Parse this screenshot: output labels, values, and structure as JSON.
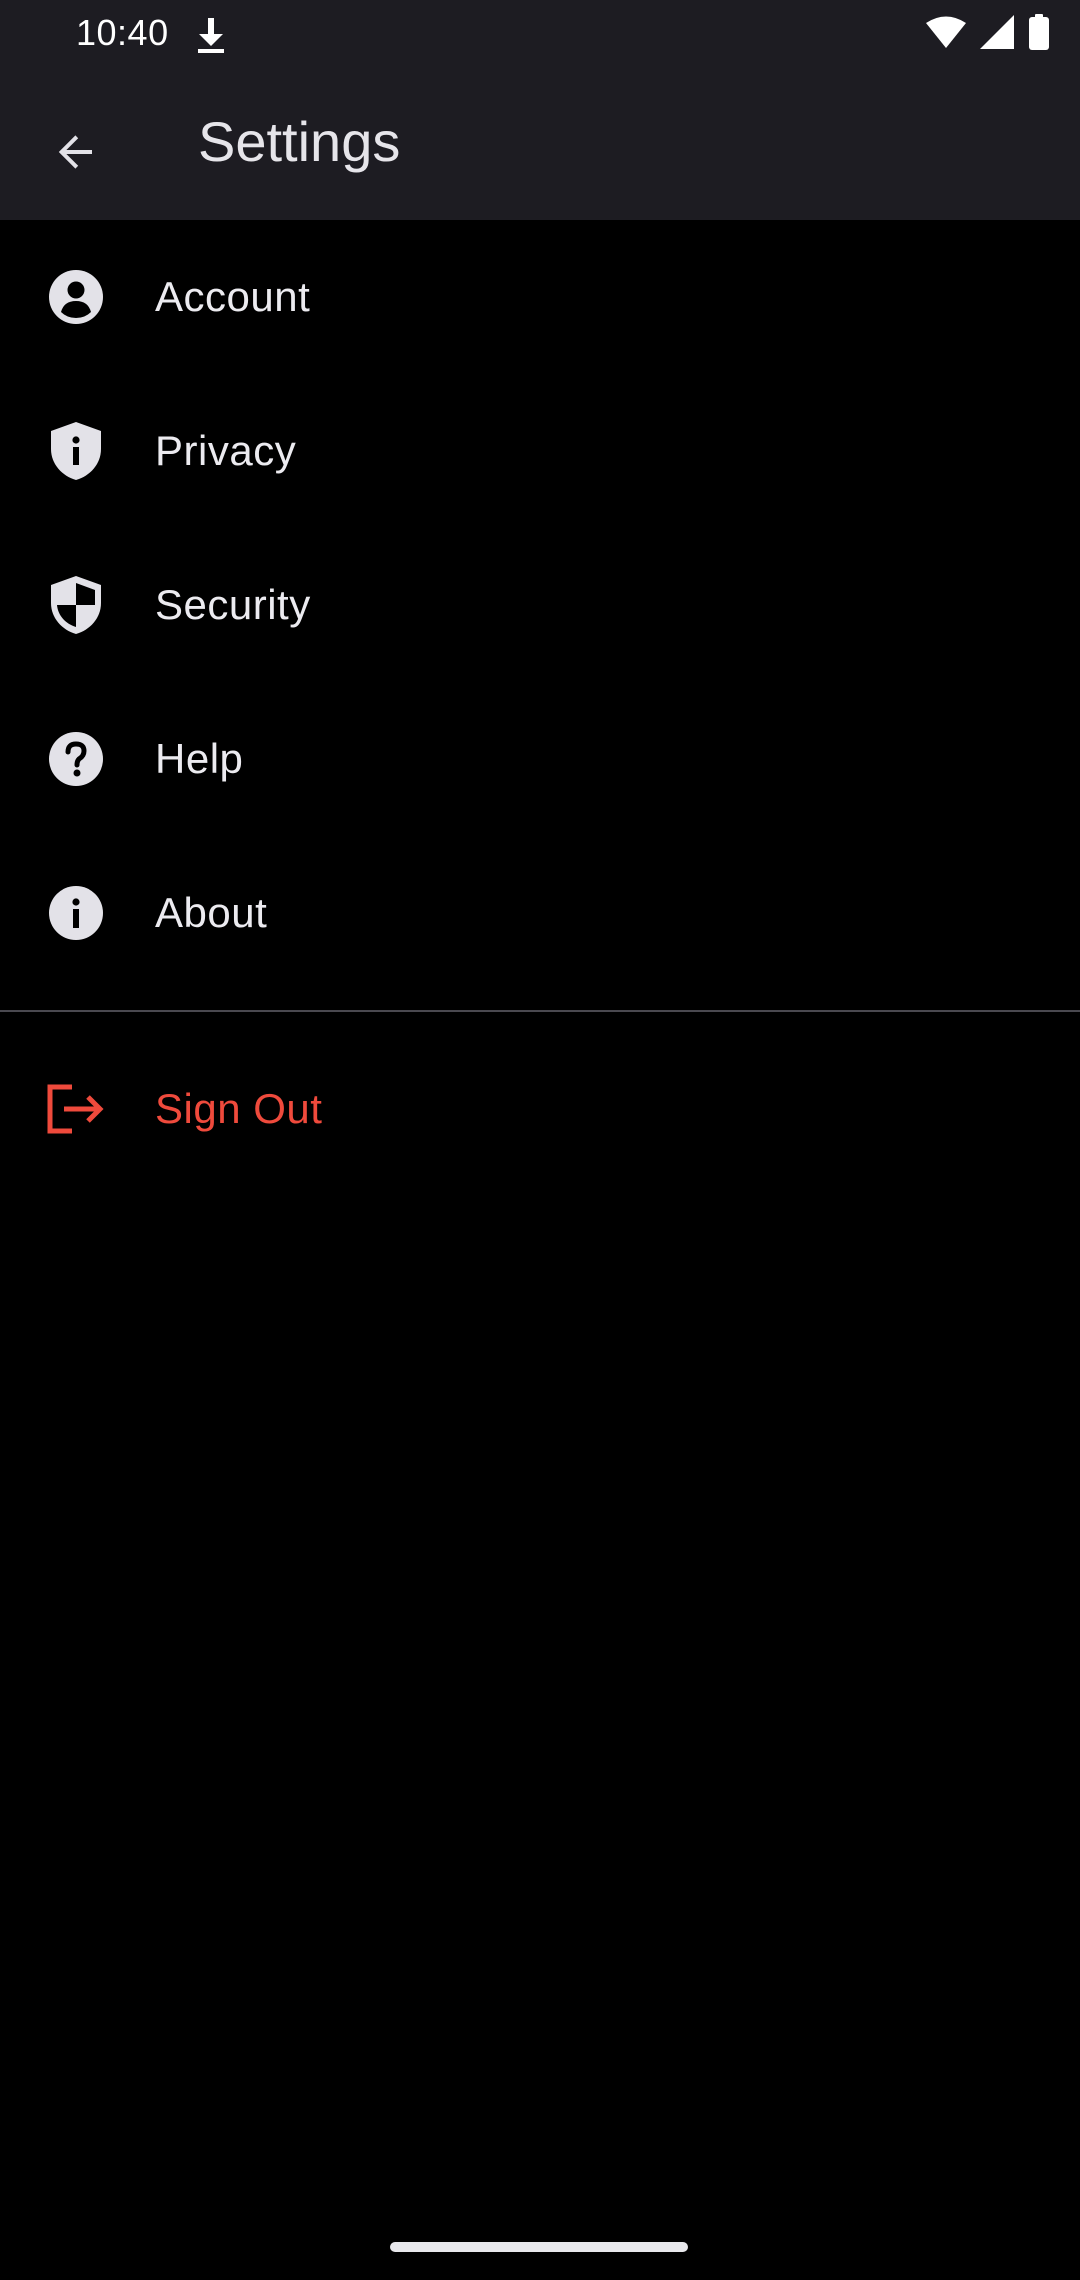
{
  "status_bar": {
    "time": "10:40",
    "icons": [
      "download-icon",
      "wifi-icon",
      "signal-icon",
      "battery-icon"
    ]
  },
  "app_bar": {
    "title": "Settings",
    "back_icon": "arrow-back-icon"
  },
  "menu": {
    "items": [
      {
        "label": "Account",
        "icon": "account-circle-icon"
      },
      {
        "label": "Privacy",
        "icon": "privacy-shield-icon"
      },
      {
        "label": "Security",
        "icon": "security-shield-icon"
      },
      {
        "label": "Help",
        "icon": "help-icon"
      },
      {
        "label": "About",
        "icon": "info-icon"
      }
    ],
    "sign_out": {
      "label": "Sign Out",
      "icon": "logout-icon"
    }
  },
  "colors": {
    "app_bar_background": "#1D1C22",
    "page_background": "#000000",
    "text_primary": "#ECEBF0",
    "icon_color": "#E3E2E8",
    "danger": "#EF4A3C",
    "divider": "#4A4950"
  }
}
